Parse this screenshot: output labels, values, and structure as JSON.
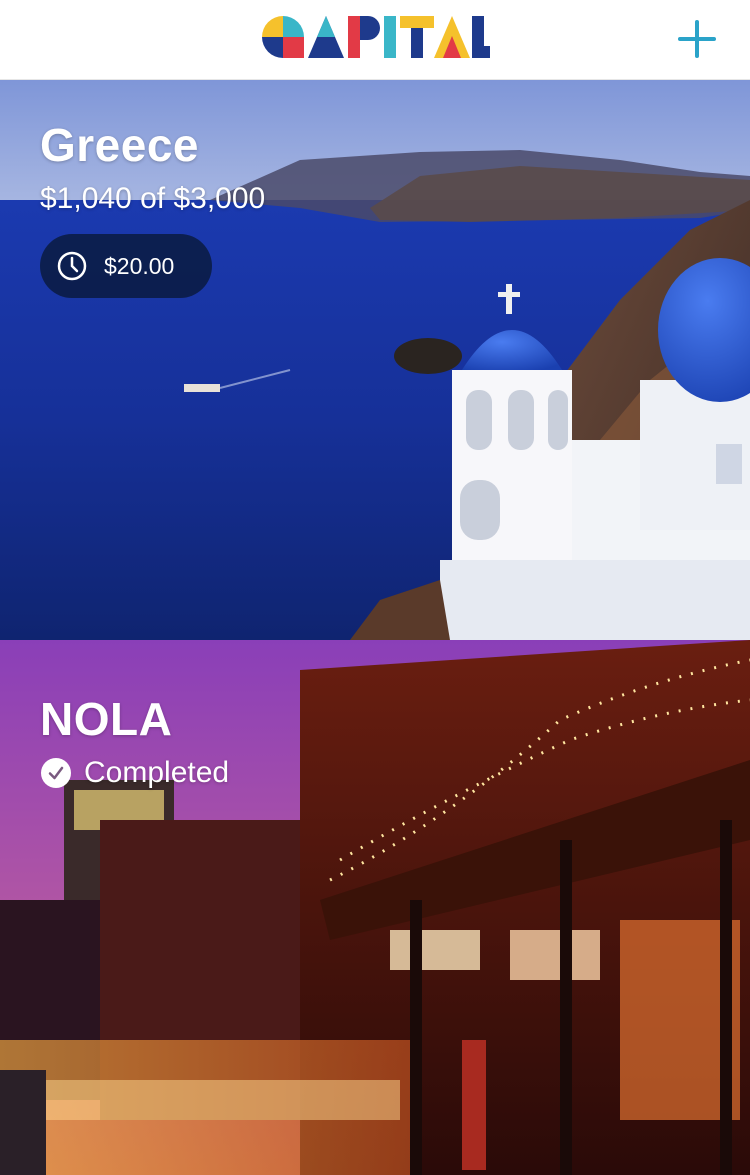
{
  "header": {
    "logo_text": "QAPITAL",
    "add_button_label": "+"
  },
  "goals": [
    {
      "name": "Greece",
      "progress_text": "$1,040 of $3,000",
      "saved": 1040,
      "target": 3000,
      "scheduled_amount": "$20.00",
      "scheduled_icon": "clock-icon"
    },
    {
      "name": "NOLA",
      "status_text": "Completed",
      "status_icon": "check-circle-icon"
    }
  ],
  "colors": {
    "pill_background": "#0a1a3c",
    "add_button": "#2aa3c9",
    "logo_blue": "#1e3a8c",
    "logo_red": "#e23a46",
    "logo_yellow": "#f5c12c",
    "logo_teal": "#3ab6c8"
  }
}
